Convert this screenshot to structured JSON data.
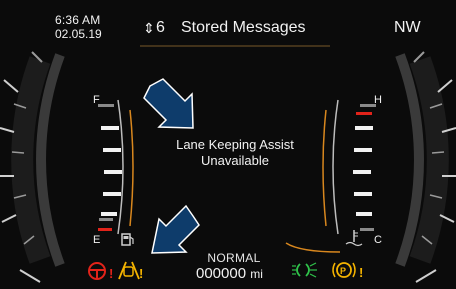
{
  "status_bar": {
    "time": "6:36 AM",
    "date": "02.05.19",
    "menu_arrows": "⇕",
    "menu_count": "6",
    "menu_title": "Stored Messages",
    "compass": "NW"
  },
  "message": {
    "line1": "Lane Keeping Assist",
    "line2": "Unavailable"
  },
  "fuel_gauge": {
    "full_label": "F",
    "empty_label": "E",
    "level": 0.85
  },
  "temp_gauge": {
    "hot_label": "H",
    "cold_label": "C",
    "level": 0.5
  },
  "odometer": {
    "mode": "NORMAL",
    "value": "000000",
    "unit": "mi"
  },
  "colors": {
    "background": "#0b0b0b",
    "callout_arrow": "#0e3c6b",
    "warning_red": "#e2231a",
    "warning_amber": "#f5b400",
    "lamp_green": "#2fc24a",
    "accent_orange": "#d8871e"
  },
  "icons": [
    "steering-wheel-warning-icon",
    "lane-departure-warning-icon",
    "fuel-pump-icon",
    "coolant-temperature-icon",
    "parking-lamp-icon",
    "parking-brake-warning-icon",
    "callout-arrow-icon"
  ]
}
